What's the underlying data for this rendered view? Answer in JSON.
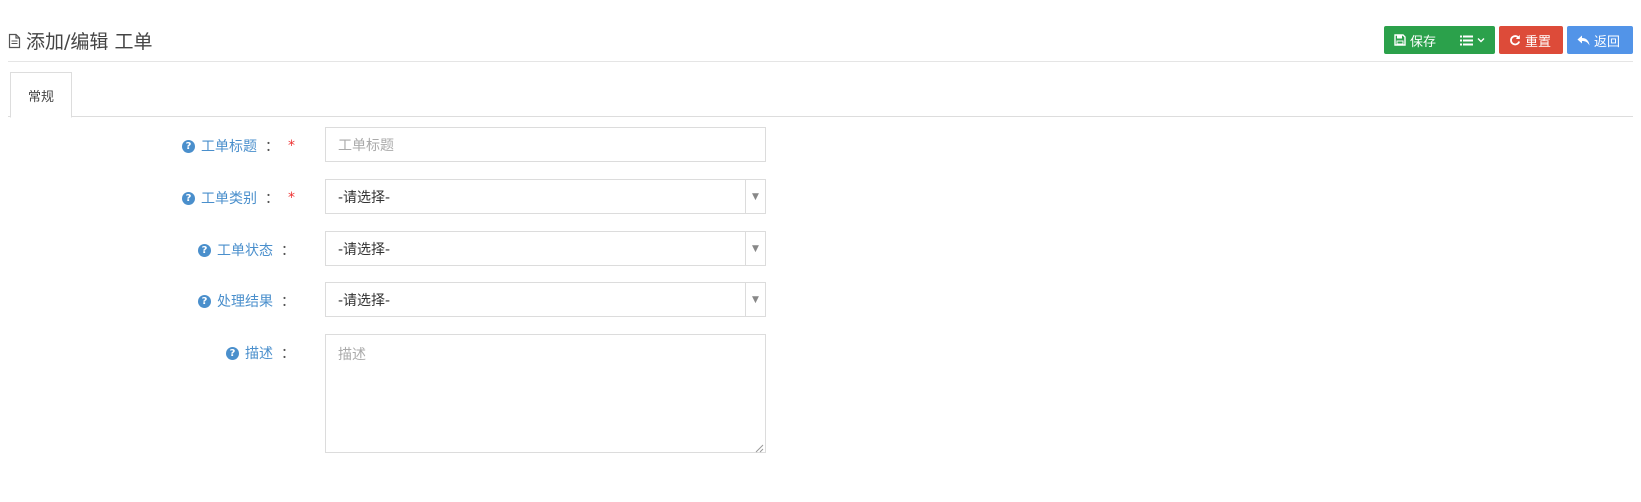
{
  "header": {
    "title": "添加/编辑 工单",
    "title_icon": "document-icon",
    "buttons": {
      "save": "保存",
      "menu_icon": "list-icon",
      "reset": "重置",
      "back": "返回"
    },
    "colors": {
      "save": "#2ba14b",
      "reset": "#dd4b39",
      "back": "#5294e8"
    }
  },
  "tabs": [
    {
      "label": "常规",
      "active": true
    }
  ],
  "form": {
    "colon": "：",
    "required_mark": "*",
    "help_icon": "question-circle-icon",
    "fields": [
      {
        "label": "工单标题",
        "type": "text",
        "placeholder": "工单标题",
        "value": "",
        "required": true
      },
      {
        "label": "工单类别",
        "type": "select",
        "value": "-请选择-",
        "required": true
      },
      {
        "label": "工单状态",
        "type": "select",
        "value": "-请选择-",
        "required": false
      },
      {
        "label": "处理结果",
        "type": "select",
        "value": "-请选择-",
        "required": false
      },
      {
        "label": "描述",
        "type": "textarea",
        "placeholder": "描述",
        "value": "",
        "required": false
      }
    ]
  }
}
